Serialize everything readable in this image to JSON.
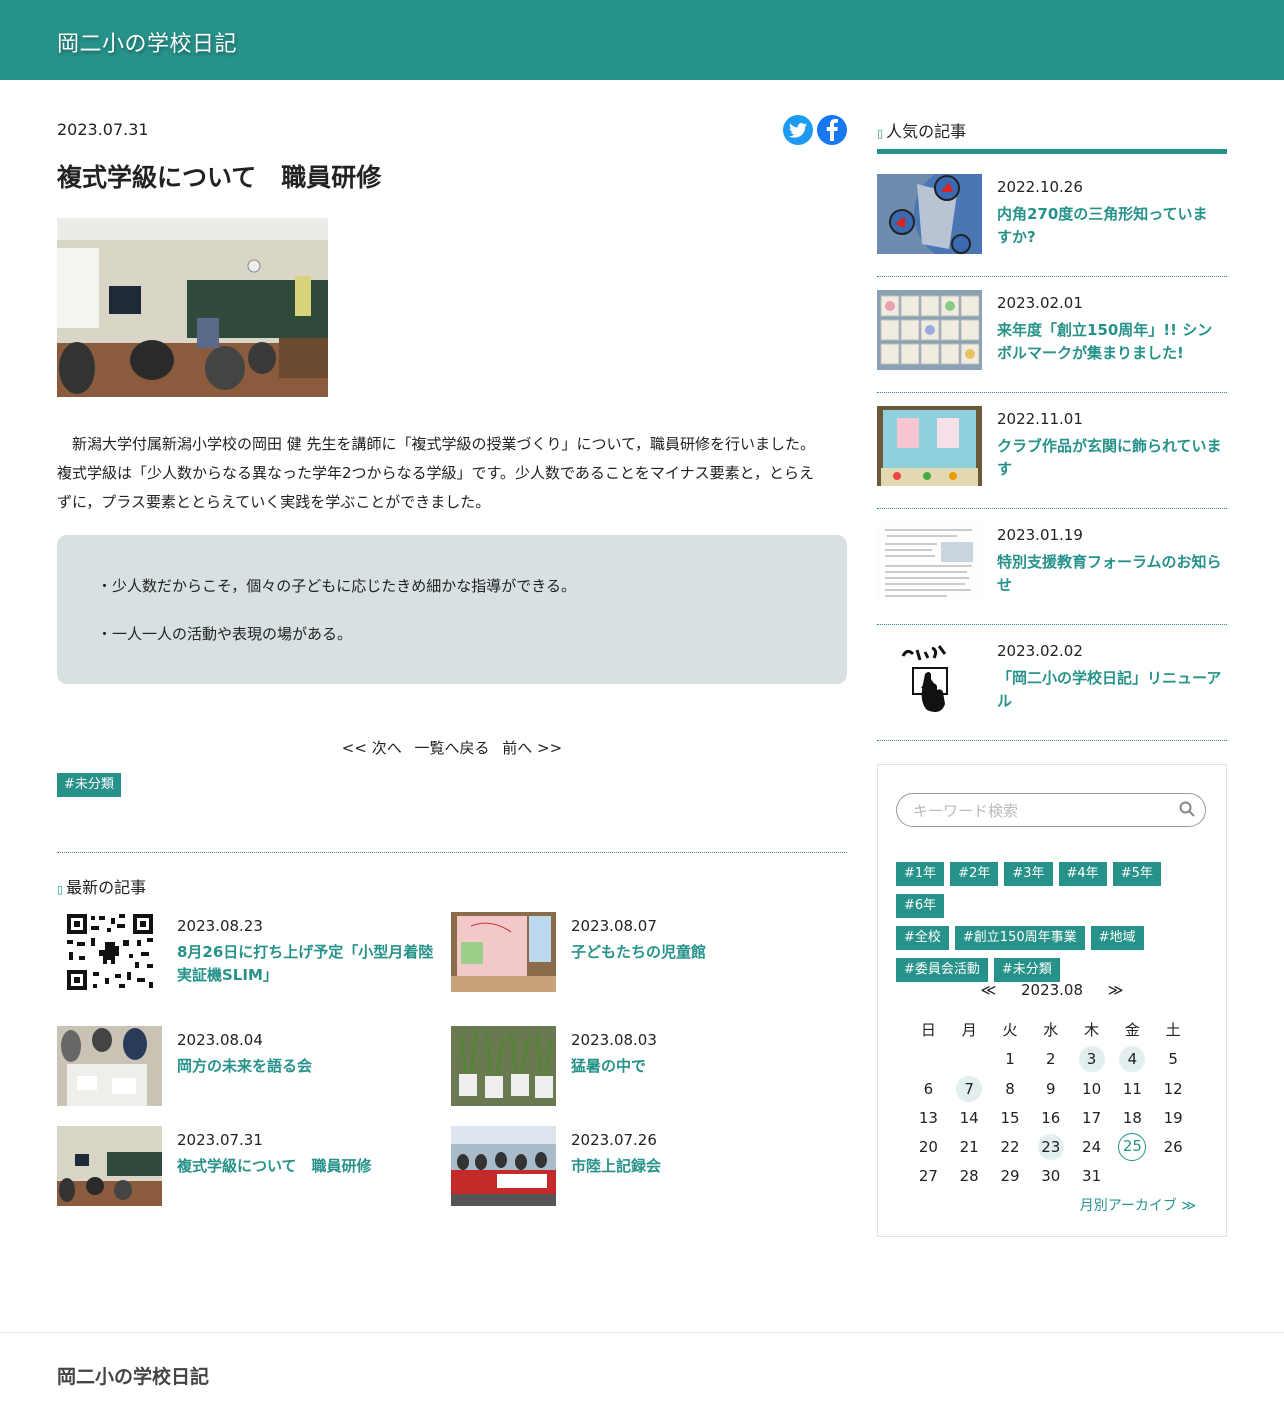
{
  "site": {
    "title": "岡二小の学校日記"
  },
  "post": {
    "date": "2023.07.31",
    "title": "複式学級について　職員研修",
    "body": "　新潟大学付属新潟小学校の岡田 健 先生を講師に「複式学級の授業づくり」について，職員研修を行いました。複式学級は「少人数からなる異なった学年2つからなる学級」です。少人数であることをマイナス要素と，とらえずに，プラス要素ととらえていく実践を学ぶことができました。",
    "points": [
      "・少人数だからこそ，個々の子どもに応じたきめ細かな指導ができる。",
      "・一人一人の活動や表現の場がある。"
    ],
    "pager": {
      "next": "<< 次へ",
      "list": "一覧へ戻る",
      "prev": "前へ >>"
    },
    "category": "#未分類"
  },
  "latest": {
    "heading": "最新の記事",
    "items": [
      {
        "date": "2023.08.23",
        "title": "8月26日に打ち上げ予定「小型月着陸実証機SLIM」"
      },
      {
        "date": "2023.08.07",
        "title": "子どもたちの児童館"
      },
      {
        "date": "2023.08.04",
        "title": "岡方の未来を語る会"
      },
      {
        "date": "2023.08.03",
        "title": "猛暑の中で"
      },
      {
        "date": "2023.07.31",
        "title": "複式学級について　職員研修"
      },
      {
        "date": "2023.07.26",
        "title": "市陸上記録会"
      }
    ]
  },
  "popular": {
    "heading": "人気の記事",
    "items": [
      {
        "date": "2022.10.26",
        "title": "内角270度の三角形知っていますか?"
      },
      {
        "date": "2023.02.01",
        "title": "来年度「創立150周年」!! シンボルマークが集まりました!"
      },
      {
        "date": "2022.11.01",
        "title": "クラブ作品が玄関に飾られています"
      },
      {
        "date": "2023.01.19",
        "title": "特別支援教育フォーラムのお知らせ"
      },
      {
        "date": "2023.02.02",
        "title": "「岡二小の学校日記」リニューアル"
      }
    ]
  },
  "search": {
    "placeholder": "キーワード検索"
  },
  "tags": [
    "#1年",
    "#2年",
    "#3年",
    "#4年",
    "#5年",
    "#6年",
    "#全校",
    "#創立150周年事業",
    "#地域",
    "#委員会活動",
    "#未分類"
  ],
  "calendar": {
    "prev": "≪",
    "month": "2023.08",
    "next": "≫",
    "weekdays": [
      "日",
      "月",
      "火",
      "水",
      "木",
      "金",
      "土"
    ],
    "weeks": [
      [
        "",
        "",
        "1",
        "2",
        "3",
        "4",
        "5"
      ],
      [
        "6",
        "7",
        "8",
        "9",
        "10",
        "11",
        "12"
      ],
      [
        "13",
        "14",
        "15",
        "16",
        "17",
        "18",
        "19"
      ],
      [
        "20",
        "21",
        "22",
        "23",
        "24",
        "25",
        "26"
      ],
      [
        "27",
        "28",
        "29",
        "30",
        "31",
        "",
        ""
      ]
    ],
    "highlighted_days": [
      "3",
      "4",
      "7",
      "23"
    ],
    "today": "25",
    "archive_link": "月別アーカイブ ≫"
  },
  "colors": {
    "accent": "#26928a",
    "note_bg": "#d7e1e1"
  },
  "footer": {
    "title": "岡二小の学校日記"
  }
}
